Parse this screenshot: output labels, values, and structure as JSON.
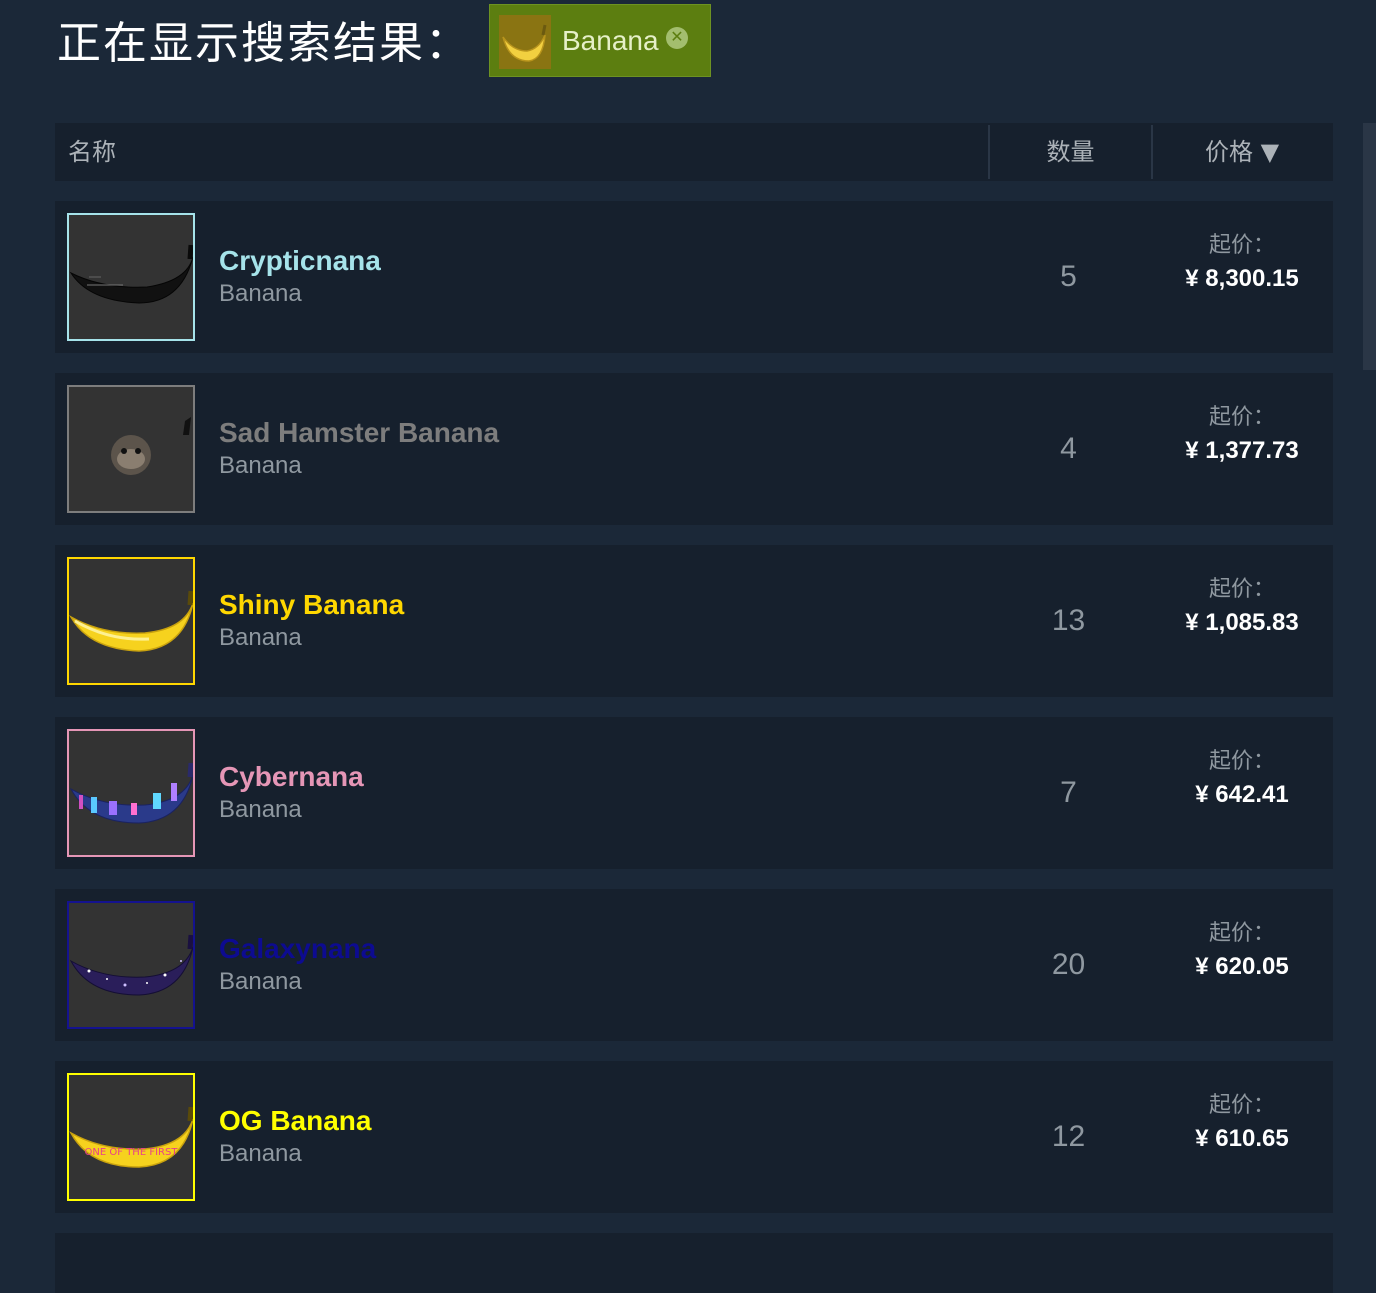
{
  "heading": "正在显示搜索结果：",
  "filter_tag": {
    "label": "Banana",
    "close_symbol": "✕",
    "icon": "banana-icon"
  },
  "table": {
    "columns": {
      "name": "名称",
      "quantity": "数量",
      "price": "价格 ▼"
    }
  },
  "items": [
    {
      "name": "Crypticnana",
      "game": "Banana",
      "quantity": "5",
      "price_label": "起价：",
      "price": "¥ 8,300.15",
      "name_color": "#a6e3ea",
      "border_color": "#a6e3ea",
      "icon": "black-banana-icon"
    },
    {
      "name": "Sad Hamster Banana",
      "game": "Banana",
      "quantity": "4",
      "price_label": "起价：",
      "price": "¥ 1,377.73",
      "name_color": "#7d7d7d",
      "border_color": "#7d7d7d",
      "icon": "hamster-icon"
    },
    {
      "name": "Shiny Banana",
      "game": "Banana",
      "quantity": "13",
      "price_label": "起价：",
      "price": "¥ 1,085.83",
      "name_color": "#ffd700",
      "border_color": "#ffd700",
      "icon": "yellow-banana-icon"
    },
    {
      "name": "Cybernana",
      "game": "Banana",
      "quantity": "7",
      "price_label": "起价：",
      "price": "¥ 642.41",
      "name_color": "#e596b6",
      "border_color": "#e596b6",
      "icon": "cyber-banana-icon"
    },
    {
      "name": "Galaxynana",
      "game": "Banana",
      "quantity": "20",
      "price_label": "起价：",
      "price": "¥ 620.05",
      "name_color": "#0d0b91",
      "border_color": "#14128f",
      "icon": "galaxy-banana-icon"
    },
    {
      "name": "OG Banana",
      "game": "Banana",
      "quantity": "12",
      "price_label": "起价：",
      "price": "¥ 610.65",
      "name_color": "#ffff00",
      "border_color": "#ffff00",
      "icon": "og-banana-icon",
      "icon_text": "ONE OF THE FIRST"
    }
  ]
}
